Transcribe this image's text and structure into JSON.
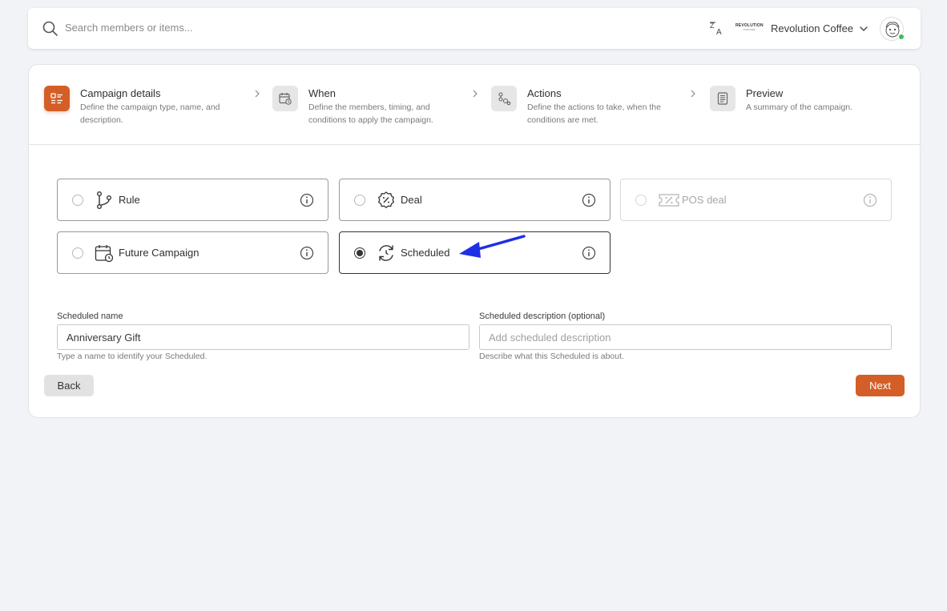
{
  "header": {
    "search_placeholder": "Search members or items...",
    "brand_logo_text": "REVOLUTION",
    "brand_logo_sub": "COFFEE",
    "brand_name": "Revolution Coffee"
  },
  "stepper": [
    {
      "title": "Campaign details",
      "description": "Define the campaign type, name, and description.",
      "active": true,
      "icon": "list-icon"
    },
    {
      "title": "When",
      "description": "Define the members, timing, and conditions to apply the campaign.",
      "active": false,
      "icon": "calendar-clock-icon"
    },
    {
      "title": "Actions",
      "description": "Define the actions to take, when the conditions are met.",
      "active": false,
      "icon": "actions-icon"
    },
    {
      "title": "Preview",
      "description": "A summary of the campaign.",
      "active": false,
      "icon": "document-icon"
    }
  ],
  "types": [
    {
      "label": "Rule",
      "selected": false,
      "disabled": false,
      "icon": "branch-icon"
    },
    {
      "label": "Deal",
      "selected": false,
      "disabled": false,
      "icon": "percent-badge-icon"
    },
    {
      "label": "POS deal",
      "selected": false,
      "disabled": true,
      "icon": "ticket-percent-icon"
    },
    {
      "label": "Future Campaign",
      "selected": false,
      "disabled": false,
      "icon": "calendar-clock-icon"
    },
    {
      "label": "Scheduled",
      "selected": true,
      "disabled": false,
      "icon": "refresh-clock-icon"
    }
  ],
  "form": {
    "name_label": "Scheduled name",
    "name_value": "Anniversary Gift",
    "name_hint": "Type a name to identify your Scheduled.",
    "desc_label": "Scheduled description (optional)",
    "desc_placeholder": "Add scheduled description",
    "desc_hint": "Describe what this Scheduled is about."
  },
  "buttons": {
    "back": "Back",
    "next": "Next"
  },
  "colors": {
    "accent": "#d45e27",
    "annotation_arrow": "#1f2fe6",
    "online": "#3cbe5a"
  }
}
